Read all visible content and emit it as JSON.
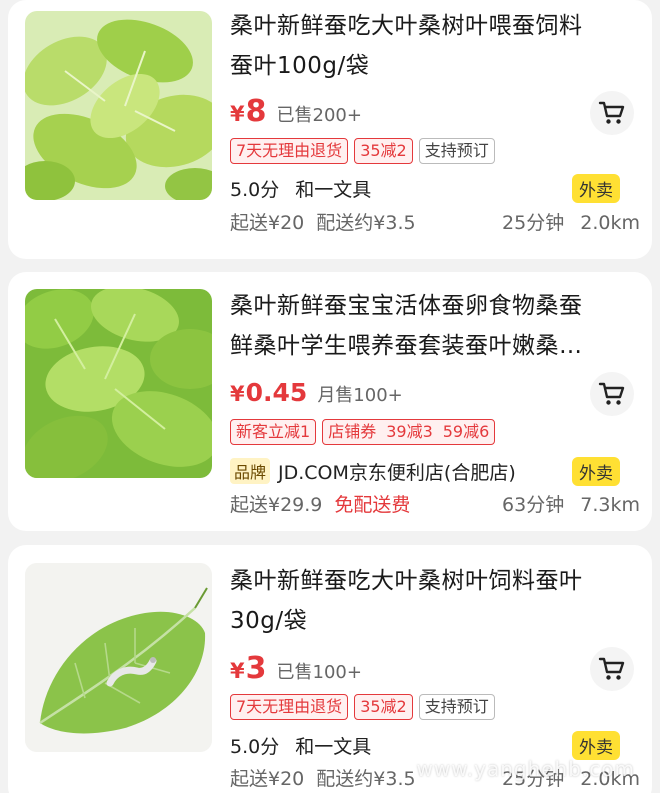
{
  "colors": {
    "price_red": "#e4393c",
    "waimai_yellow": "#ffe033",
    "background": "#f2f2f2"
  },
  "products": [
    {
      "title_lines": [
        "桑叶新鲜蚕吃大叶桑树叶喂蚕饲料",
        "蚕叶100g/袋"
      ],
      "currency": "¥",
      "price": "8",
      "sold": "已售200+",
      "tags": [
        "7天无理由退货",
        "35减2",
        "支持预订"
      ],
      "rating": "5.0分",
      "shop": "和一文具",
      "waimai": "外卖",
      "min_order": "起送¥20",
      "delivery_fee": "配送约¥3.5",
      "eta": "25分钟",
      "distance": "2.0km",
      "icon": "cart-icon"
    },
    {
      "title_lines": [
        "桑叶新鲜蚕宝宝活体蚕卵食物桑蚕",
        "鲜桑叶学生喂养蚕套装蚕叶嫩桑…"
      ],
      "currency": "¥",
      "price": "0.45",
      "sold": "月售100+",
      "tags": [
        "新客立减1",
        "店铺券",
        "39减3",
        "59减6"
      ],
      "brand": "品牌",
      "shop": "JD.COM京东便利店(合肥店)",
      "waimai": "外卖",
      "min_order": "起送¥29.9",
      "free_delivery": "免配送费",
      "eta": "63分钟",
      "distance": "7.3km",
      "icon": "cart-icon"
    },
    {
      "title_lines": [
        "桑叶新鲜蚕吃大叶桑树叶饲料蚕叶",
        "30g/袋"
      ],
      "currency": "¥",
      "price": "3",
      "sold": "已售100+",
      "tags": [
        "7天无理由退货",
        "35减2",
        "支持预订"
      ],
      "rating": "5.0分",
      "shop": "和一文具",
      "waimai": "外卖",
      "min_order": "起送¥20",
      "delivery_fee": "配送约¥3.5",
      "eta": "25分钟",
      "distance": "2.0km",
      "icon": "cart-icon"
    }
  ],
  "watermark": "www.yanghehb.com"
}
